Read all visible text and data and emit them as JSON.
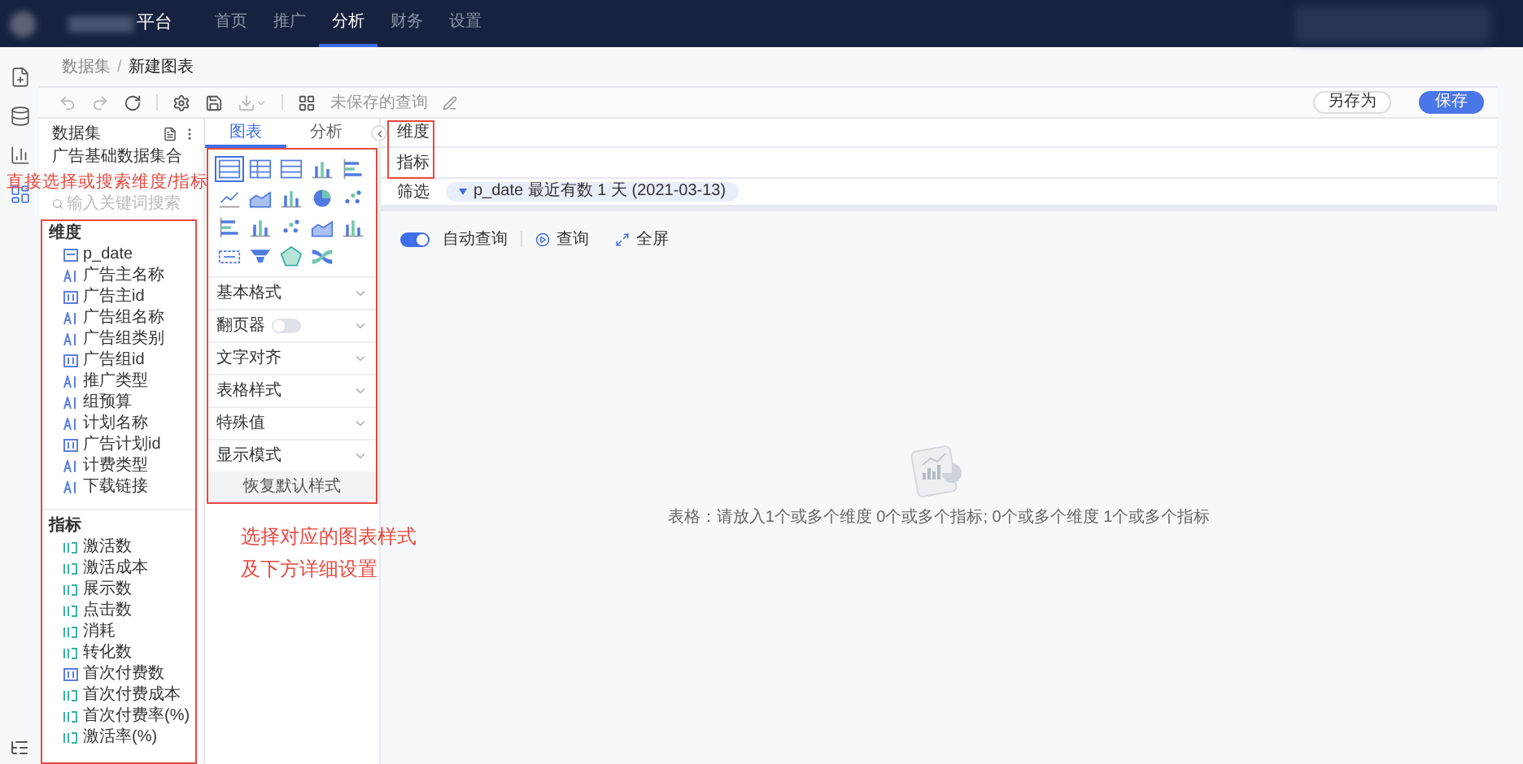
{
  "top_nav": {
    "brand": "平台",
    "items": [
      {
        "label": "首页",
        "selected": false
      },
      {
        "label": "推广",
        "selected": false
      },
      {
        "label": "分析",
        "selected": true
      },
      {
        "label": "财务",
        "selected": false
      },
      {
        "label": "设置",
        "selected": false
      }
    ]
  },
  "side_rail": {
    "items": [
      {
        "selected": false
      },
      {
        "selected": false
      },
      {
        "selected": false
      },
      {
        "selected": true
      }
    ]
  },
  "breadcrumb": {
    "items": [
      "数据集",
      "新建图表"
    ],
    "separator": "/"
  },
  "toolbar": {
    "query_name": "未保存的查询",
    "save_as_button": "另存为",
    "save_button": "保存"
  },
  "dataset_panel": {
    "title": "数据集",
    "dataset": "广告基础数据集合",
    "search": {
      "placeholder": "输入关键词搜索"
    },
    "dimensions": {
      "title": "维度",
      "fields": [
        {
          "name": "p_date",
          "kind": "date"
        },
        {
          "name": "广告主名称",
          "kind": "text"
        },
        {
          "name": "广告主id",
          "kind": "number"
        },
        {
          "name": "广告组名称",
          "kind": "text"
        },
        {
          "name": "广告组类别",
          "kind": "text"
        },
        {
          "name": "广告组id",
          "kind": "number"
        },
        {
          "name": "推广类型",
          "kind": "text"
        },
        {
          "name": "组预算",
          "kind": "text"
        },
        {
          "name": "计划名称",
          "kind": "text"
        },
        {
          "name": "广告计划id",
          "kind": "number"
        },
        {
          "name": "计费类型",
          "kind": "text"
        },
        {
          "name": "下载链接",
          "kind": "text"
        }
      ]
    },
    "metrics": {
      "title": "指标",
      "fields": [
        {
          "name": "激活数",
          "kind": "measure"
        },
        {
          "name": "激活成本",
          "kind": "measure"
        },
        {
          "name": "展示数",
          "kind": "measure"
        },
        {
          "name": "点击数",
          "kind": "measure"
        },
        {
          "name": "消耗",
          "kind": "measure"
        },
        {
          "name": "转化数",
          "kind": "measure"
        },
        {
          "name": "首次付费数",
          "kind": "number"
        },
        {
          "name": "首次付费成本",
          "kind": "measure"
        },
        {
          "name": "首次付费率(%)",
          "kind": "measure"
        },
        {
          "name": "激活率(%)",
          "kind": "measure"
        }
      ]
    }
  },
  "chart_panel": {
    "tabs": [
      {
        "label": "图表",
        "selected": true
      },
      {
        "label": "分析",
        "selected": false
      }
    ],
    "chart_types": [
      {
        "kind": "table",
        "selected": true
      },
      {
        "kind": "pivot",
        "selected": false
      },
      {
        "kind": "table",
        "selected": false
      },
      {
        "kind": "bar",
        "selected": false
      },
      {
        "kind": "hbar",
        "selected": false
      },
      {
        "kind": "line",
        "selected": false
      },
      {
        "kind": "area",
        "selected": false
      },
      {
        "kind": "bar",
        "selected": false
      },
      {
        "kind": "pie",
        "selected": false
      },
      {
        "kind": "scatter",
        "selected": false
      },
      {
        "kind": "hbar",
        "selected": false
      },
      {
        "kind": "bar",
        "selected": false
      },
      {
        "kind": "scatter",
        "selected": false
      },
      {
        "kind": "area",
        "selected": false
      },
      {
        "kind": "bar",
        "selected": false
      },
      {
        "kind": "card",
        "selected": false
      },
      {
        "kind": "funnel",
        "selected": false
      },
      {
        "kind": "radar",
        "selected": false
      },
      {
        "kind": "sankey",
        "selected": false
      }
    ],
    "sections": [
      {
        "label": "基本格式",
        "kind": "plain"
      },
      {
        "label": "翻页器",
        "kind": "toggle",
        "on": false
      },
      {
        "label": "文字对齐",
        "kind": "plain"
      },
      {
        "label": "表格样式",
        "kind": "plain"
      },
      {
        "label": "特殊值",
        "kind": "plain"
      },
      {
        "label": "显示模式",
        "kind": "plain"
      }
    ],
    "reset_button": "恢复默认样式"
  },
  "query_area": {
    "dimensions_label": "维度",
    "metrics_label": "指标",
    "filter": {
      "label": "筛选",
      "chip": "p_date 最近有数 1 天 (2021-03-13)"
    },
    "auto_query": {
      "label": "自动查询",
      "on": true
    },
    "query_button": "查询",
    "fullscreen_button": "全屏",
    "empty_message": "表格：请放入1个或多个维度 0个或多个指标; 0个或多个维度 1个或多个指标"
  },
  "annotations": [
    "直接选择或搜索维度/指标",
    "选择对应的图表样式",
    "及下方详细设置"
  ]
}
